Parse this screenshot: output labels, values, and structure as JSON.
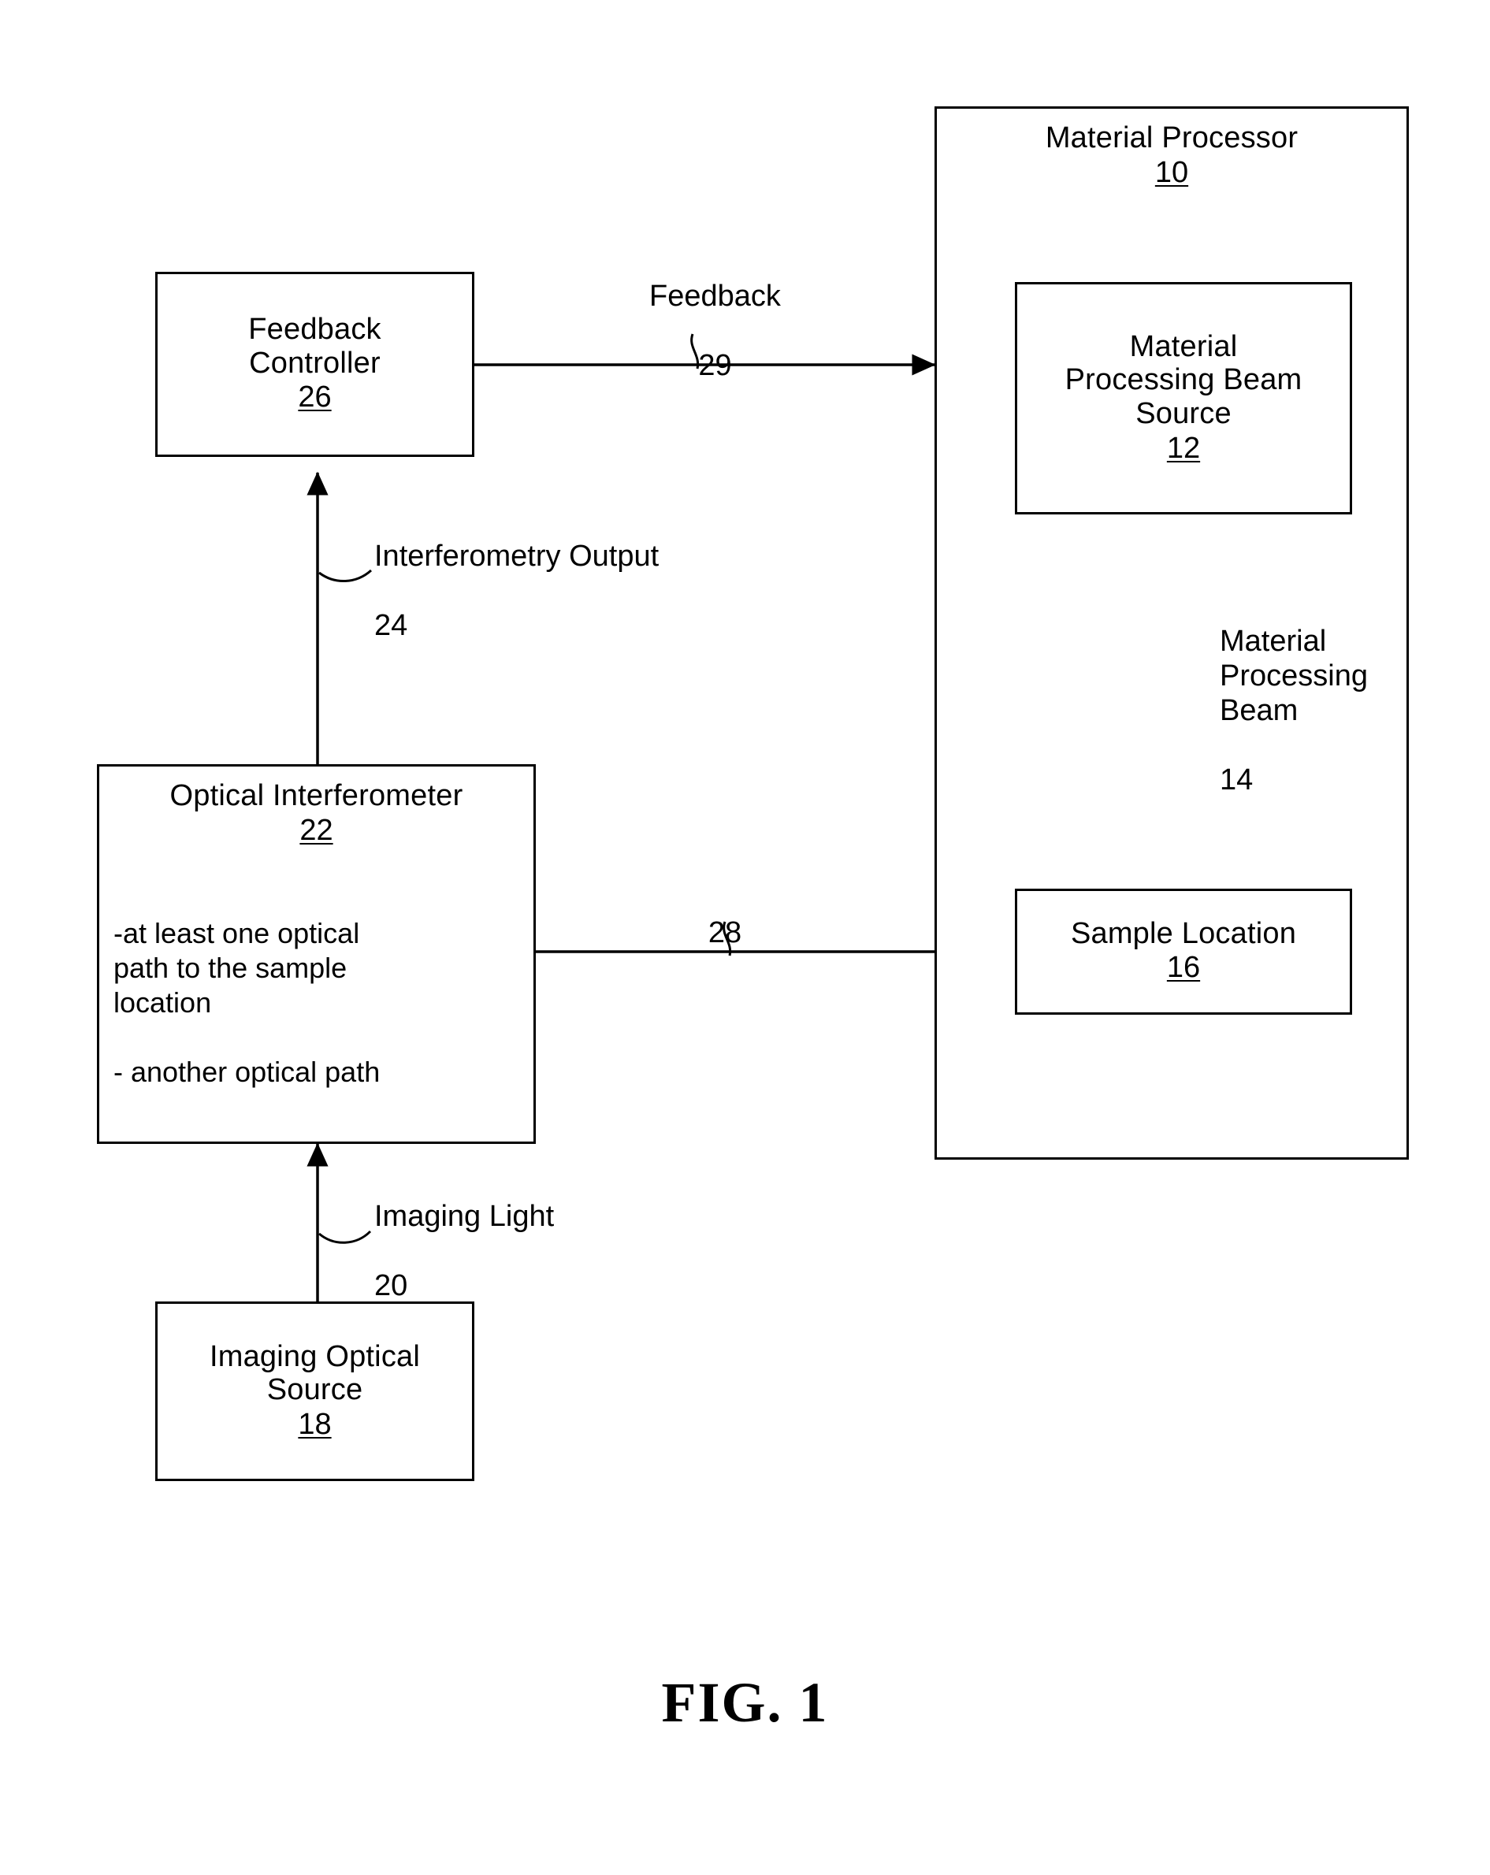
{
  "figure": {
    "caption": "FIG. 1",
    "title": "Material Processor block diagram"
  },
  "blocks": {
    "material_processor": {
      "title": "Material Processor",
      "ref": "10"
    },
    "material_processing_beam_source": {
      "title": "Material\nProcessing Beam\nSource",
      "ref": "12"
    },
    "sample_location": {
      "title": "Sample Location",
      "ref": "16"
    },
    "feedback_controller": {
      "title": "Feedback\nController",
      "ref": "26"
    },
    "optical_interferometer": {
      "title": "Optical Interferometer",
      "ref": "22",
      "bullets": [
        "-at least one optical\n path to the sample\n location",
        "- another optical path"
      ]
    },
    "imaging_optical_source": {
      "title": "Imaging Optical\nSource",
      "ref": "18"
    }
  },
  "connectors": {
    "feedback": {
      "label": "Feedback",
      "ref": "29"
    },
    "interferometry_output": {
      "label": "Interferometry Output",
      "ref": "24"
    },
    "material_processing_beam": {
      "label": "Material\nProcessing\nBeam",
      "ref": "14"
    },
    "sample_path": {
      "label": "",
      "ref": "28"
    },
    "imaging_light": {
      "label": "Imaging Light",
      "ref": "20"
    }
  },
  "colors": {
    "ink": "#000000",
    "paper": "#ffffff"
  }
}
